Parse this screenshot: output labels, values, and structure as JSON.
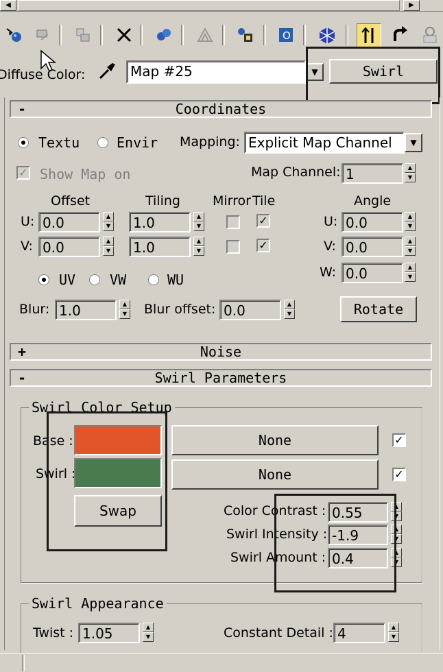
{
  "toolbar": {
    "icons": [
      "get-material-icon",
      "put-to-scene-icon",
      "put-to-library-icon",
      "delete-icon",
      "make-unique-icon",
      "material-effects-channel-icon",
      "show-map-icon",
      "show-end-result-icon",
      "go-to-parent-icon",
      "go-forward-to-sibling-icon",
      "pick-material-icon",
      "material-map-navigator-icon"
    ]
  },
  "header": {
    "slot_label": "Diffuse Color:",
    "map_name": "Map #25",
    "map_type_button": "Swirl"
  },
  "coordinates": {
    "rollout_sign": "-",
    "title": "Coordinates",
    "radio_texture": "Textu",
    "radio_environ": "Envir",
    "mapping_label": "Mapping:",
    "mapping_value": "Explicit Map Channel",
    "show_map_on": "Show Map on",
    "map_channel_label": "Map Channel:",
    "map_channel_value": "1",
    "col_offset": "Offset",
    "col_tiling": "Tiling",
    "col_mirror": "Mirror",
    "col_tile": "Tile",
    "col_angle": "Angle",
    "u_label": "U:",
    "v_label": "V:",
    "w_label": "W:",
    "u_offset": "0.0",
    "v_offset": "0.0",
    "u_tiling": "1.0",
    "v_tiling": "1.0",
    "u_angle": "0.0",
    "v_angle": "0.0",
    "w_angle": "0.0",
    "uv": "UV",
    "vw": "VW",
    "wu": "WU",
    "blur_label": "Blur:",
    "blur_value": "1.0",
    "blur_offset_label": "Blur offset:",
    "blur_offset_value": "0.0",
    "rotate_button": "Rotate"
  },
  "noise": {
    "rollout_sign": "+",
    "title": "Noise"
  },
  "swirl": {
    "rollout_sign": "-",
    "title": "Swirl Parameters",
    "color_setup_title": "Swirl Color Setup",
    "base_label": "Base :",
    "swirl_label": "Swirl :",
    "base_map": "None",
    "swirl_map": "None",
    "swap_button": "Swap",
    "base_color": "#e2542a",
    "swirl_color": "#4b7a4f",
    "contrast_label": "Color Contrast :",
    "contrast_value": "0.55",
    "intensity_label": "Swirl Intensity :",
    "intensity_value": "-1.9",
    "amount_label": "Swirl Amount :",
    "amount_value": "0.4",
    "appearance_title": "Swirl Appearance",
    "twist_label": "Twist :",
    "twist_value": "1.05",
    "detail_label": "Constant Detail :",
    "detail_value": "4"
  }
}
